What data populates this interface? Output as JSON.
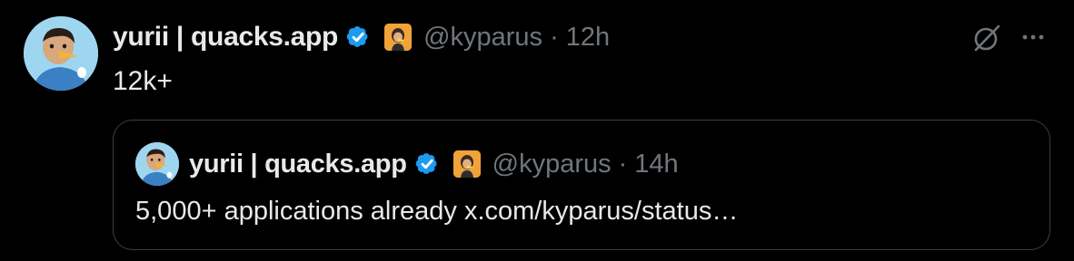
{
  "tweet": {
    "author_name": "yurii | quacks.app",
    "handle": "@kyparus",
    "separator": "·",
    "time": "12h",
    "text": "12k+"
  },
  "quoted_tweet": {
    "author_name": "yurii | quacks.app",
    "handle": "@kyparus",
    "separator": "·",
    "time": "14h",
    "text": "5,000+ applications already x.com/kyparus/status…"
  },
  "icons": {
    "verified": "verified-badge-icon",
    "affiliate": "affiliate-badge-icon",
    "grok": "grok-icon",
    "more": "more-options-icon"
  },
  "colors": {
    "background": "#000000",
    "text": "#e7e9ea",
    "muted": "#71767b",
    "verified": "#1d9bf0",
    "border": "#3a3f44"
  }
}
